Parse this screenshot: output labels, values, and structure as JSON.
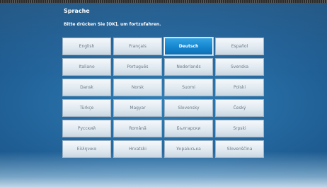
{
  "header": {
    "title": "Sprache",
    "instruction": "Bitte drücken Sie [OK], um fortzufahren."
  },
  "selected_language": "Deutsch",
  "languages": [
    "English",
    "Français",
    "Deutsch",
    "Español",
    "Italiano",
    "Português",
    "Nederlands",
    "Svenska",
    "Dansk",
    "Norsk",
    "Suomi",
    "Polski",
    "Türkçe",
    "Magyar",
    "Slovensky",
    "Český",
    "Русский",
    "Română",
    "Български",
    "Srpski",
    "Ελληνικα",
    "Hrvatski",
    "Українська",
    "Slovenščina"
  ],
  "colors": {
    "accent": "#1686cf",
    "background": "#1f5e94",
    "button_text": "#6b7a86"
  }
}
